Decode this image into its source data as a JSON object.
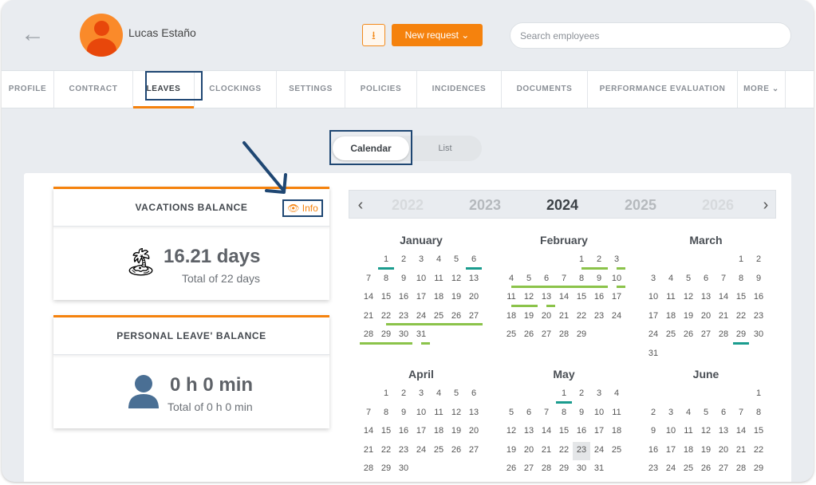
{
  "header": {
    "user_name": "Lucas Estaño",
    "new_request_label": "New request ⌄",
    "search_placeholder": "Search employees"
  },
  "tabs": [
    "PROFILE",
    "CONTRACT",
    "LEAVES",
    "CLOCKINGS",
    "SETTINGS",
    "POLICIES",
    "INCIDENCES",
    "DOCUMENTS",
    "PERFORMANCE EVALUATION",
    "MORE ⌄"
  ],
  "active_tab": "LEAVES",
  "view_toggle": {
    "calendar": "Calendar",
    "list": "List"
  },
  "vacations": {
    "title": "VACATIONS BALANCE",
    "info_label": "Info",
    "value": "16.21 days",
    "total": "Total of 22 days"
  },
  "personal": {
    "title": "PERSONAL LEAVE' BALANCE",
    "value": "0 h 0 min",
    "total": "Total of 0 h 0 min"
  },
  "years": [
    "2022",
    "2023",
    "2024",
    "2025",
    "2026"
  ],
  "selected_year": "2024",
  "months": [
    {
      "name": "January",
      "offset": 1,
      "days": 31,
      "hlGreen": [
        [
          22,
          31
        ]
      ],
      "teal": [
        1,
        6
      ],
      "gStart": [],
      "gEnd": []
    },
    {
      "name": "February",
      "offset": 4,
      "days": 29,
      "hlGreen": [
        [
          1,
          3
        ],
        [
          4,
          10
        ],
        [
          11,
          13
        ]
      ],
      "teal": [],
      "gStart": [],
      "gEnd": []
    },
    {
      "name": "March",
      "offset": 5,
      "days": 31,
      "hlGreen": [],
      "teal": [
        29
      ],
      "gStart": [],
      "gEnd": []
    },
    {
      "name": "April",
      "offset": 1,
      "days": 30,
      "hlGreen": [],
      "teal": [],
      "gStart": [],
      "gEnd": []
    },
    {
      "name": "May",
      "offset": 3,
      "days": 31,
      "hlGreen": [],
      "teal": [
        1
      ],
      "gStart": [],
      "gEnd": [],
      "grey": [
        23
      ]
    },
    {
      "name": "June",
      "offset": 6,
      "days": 30,
      "hlGreen": [],
      "teal": [],
      "gStart": [],
      "gEnd": []
    }
  ],
  "colors": {
    "accent": "#f5820d",
    "highlight_box": "#1f4773",
    "vacation_line": "#8bc34a",
    "holiday_line": "#1a9c8e"
  }
}
